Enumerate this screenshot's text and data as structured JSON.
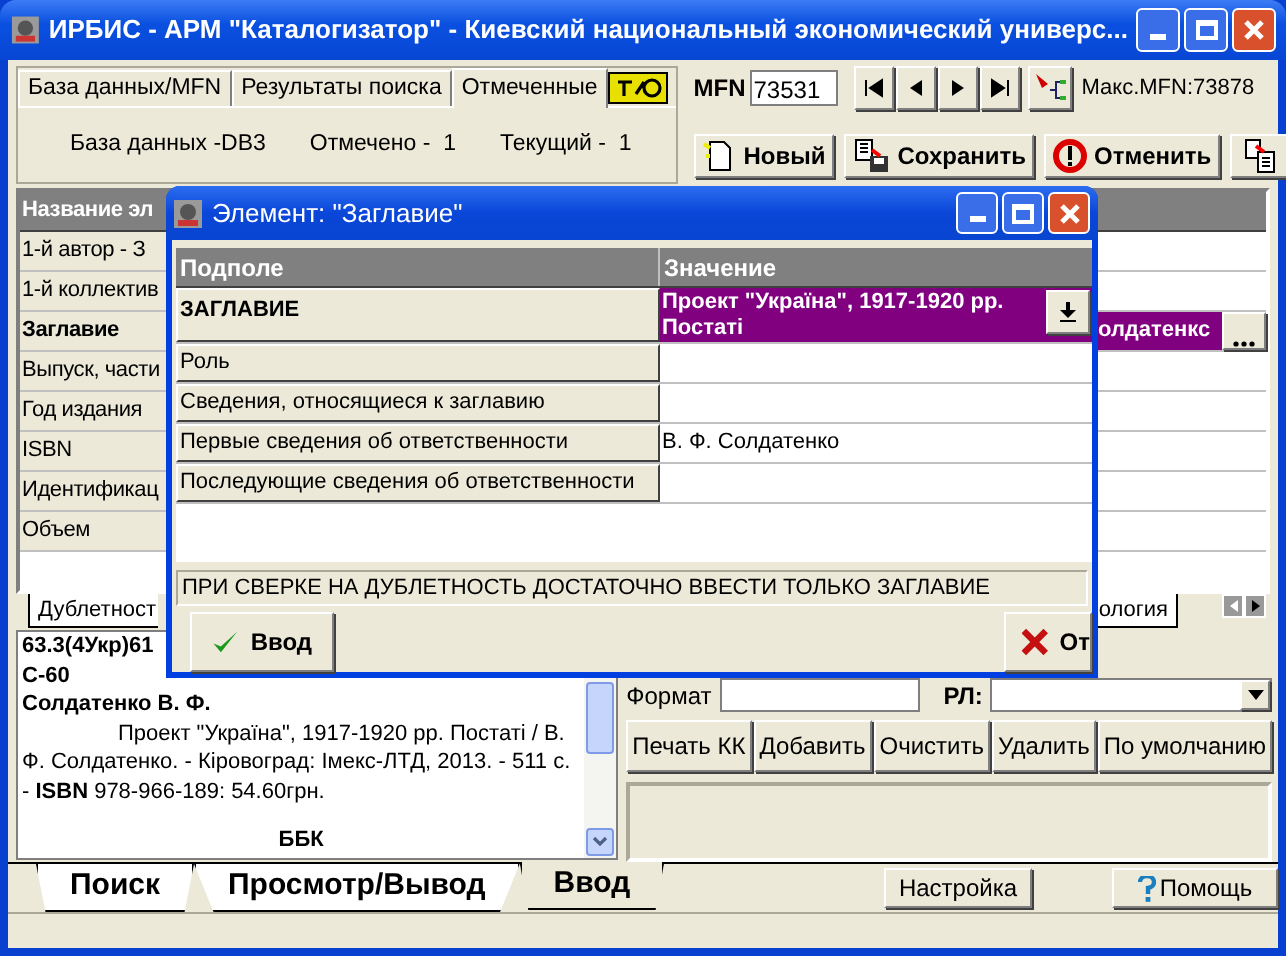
{
  "window": {
    "title": "ИРБИС - АРМ \"Каталогизатор\" - Киевский национальный экономический универс..."
  },
  "db_tabs": [
    {
      "label": "База данных/MFN",
      "selected": false
    },
    {
      "label": "Результаты поиска",
      "selected": false
    },
    {
      "label": "Отмеченные",
      "selected": true
    }
  ],
  "db_info": [
    "База данных -DB3",
    "Отмечено -  1",
    "Текущий -  1"
  ],
  "mfn": {
    "label": "MFN",
    "value": "73531",
    "max": "Макс.MFN:73878"
  },
  "record_buttons": [
    {
      "label": "Новый",
      "kind": "new"
    },
    {
      "label": "Сохранить",
      "kind": "save"
    },
    {
      "label": "Отменить",
      "kind": "cancel"
    }
  ],
  "fields_table": {
    "header": "Название эл",
    "rows": [
      {
        "name": "1-й  автор - З",
        "selected": false
      },
      {
        "name": "1-й коллектив",
        "selected": false
      },
      {
        "name": "Заглавие",
        "selected": true,
        "value": "олдатенкс"
      },
      {
        "name": "Выпуск, части",
        "selected": false
      },
      {
        "name": "Год издания",
        "selected": false
      },
      {
        "name": "ISBN",
        "selected": false
      },
      {
        "name": "Идентификац",
        "selected": false
      },
      {
        "name": "Объем",
        "selected": false
      }
    ]
  },
  "worksheet_tabs": [
    {
      "label": "Дублетност"
    },
    {
      "label": "ология"
    }
  ],
  "card_text": [
    {
      "kind": "heading",
      "text": "63.3(4Укр)61"
    },
    {
      "kind": "heading",
      "text": "С-60"
    },
    {
      "kind": "heading",
      "text": "Солдатенко В. Ф."
    },
    {
      "kind": "body",
      "text": "Проект \"Україна\", 1917-1920 рр. Постаті / В. Ф. Солдатенко. - Кіровоград: Імекс-ЛТД, 2013. - 511 с. - **ISBN** 978-966-189: 54.60грн."
    },
    {
      "kind": "section",
      "text": "ББК"
    }
  ],
  "output": {
    "format_label": "Формат",
    "rl_label": "РЛ:",
    "buttons": [
      "Печать КК",
      "Добавить",
      "Очистить",
      "Удалить",
      "По умолчанию"
    ]
  },
  "mode_tabs": [
    {
      "label": "Поиск",
      "selected": false
    },
    {
      "label": "Просмотр/Вывод",
      "selected": false
    },
    {
      "label": "Ввод",
      "selected": true
    }
  ],
  "footer_buttons": [
    {
      "label": "Настройка",
      "kind": "plain"
    },
    {
      "label": "Помощь",
      "kind": "help"
    }
  ],
  "dialog": {
    "title": "Элемент: \"Заглавие\"",
    "columns": [
      "Подполе",
      "Значение"
    ],
    "rows": [
      {
        "name": "ЗАГЛАВИЕ",
        "value": "Проект \"Україна\", 1917-1920 рр. Постаті",
        "selected": true
      },
      {
        "name": "Роль",
        "selected": false
      },
      {
        "name": "Сведения, относящиеся к заглавию",
        "selected": false
      },
      {
        "name": "Первые сведения об ответственности",
        "value": "В. Ф. Солдатенко",
        "selected": false
      },
      {
        "name": "Последующие сведения об ответственности",
        "selected": false
      }
    ],
    "hint": "ПРИ СВЕРКЕ НА ДУБЛЕТНОСТЬ ДОСТАТОЧНО ВВЕСТИ ТОЛЬКО ЗАГЛАВИЕ",
    "buttons": [
      {
        "label": "Ввод",
        "kind": "ok"
      },
      {
        "label": "От",
        "kind": "cancel"
      }
    ]
  }
}
